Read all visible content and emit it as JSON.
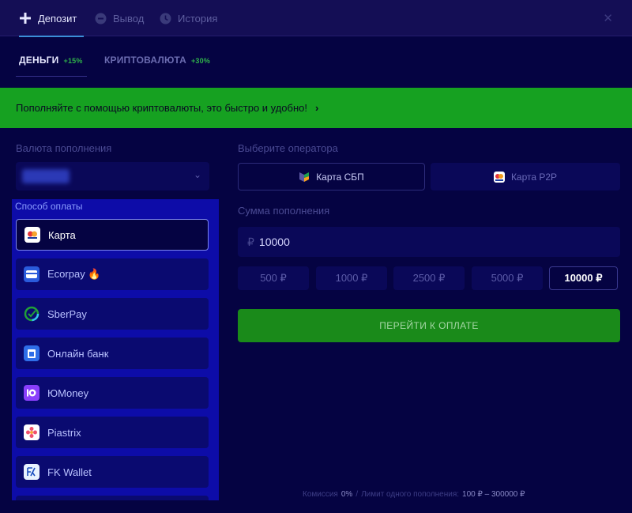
{
  "top_tabs": [
    {
      "label": "Депозит",
      "icon": "plus-icon",
      "active": true
    },
    {
      "label": "Вывод",
      "icon": "minus-circle-icon",
      "active": false
    },
    {
      "label": "История",
      "icon": "clock-icon",
      "active": false
    }
  ],
  "close_symbol": "✕",
  "sub_tabs": [
    {
      "label": "ДЕНЬГИ",
      "bonus": "+15%",
      "active": true
    },
    {
      "label": "КРИПТОВАЛЮТА",
      "bonus": "+30%",
      "active": false
    }
  ],
  "banner": {
    "text": "Пополняйте с помощью криптовалюты, это быстро и удобно!",
    "arrow": "›"
  },
  "currency": {
    "label": "Валюта пополнения",
    "chevron": "⌄"
  },
  "payment_methods": {
    "title": "Способ оплаты",
    "items": [
      {
        "label": "Карта",
        "icon": "visa-card-icon",
        "active": true
      },
      {
        "label": "Ecorpay 🔥",
        "icon": "ecorpay-icon",
        "active": false
      },
      {
        "label": "SberPay",
        "icon": "sberpay-icon",
        "active": false
      },
      {
        "label": "Онлайн банк",
        "icon": "online-bank-icon",
        "active": false
      },
      {
        "label": "ЮMoney",
        "icon": "yumoney-icon",
        "active": false
      },
      {
        "label": "Piastrix",
        "icon": "piastrix-icon",
        "active": false
      },
      {
        "label": "FK Wallet",
        "icon": "fk-wallet-icon",
        "active": false
      }
    ]
  },
  "operator": {
    "label": "Выберите оператора",
    "options": [
      {
        "label": "Карта СБП",
        "icon": "sbp-icon",
        "active": true
      },
      {
        "label": "Карта P2P",
        "icon": "p2p-card-icon",
        "active": false
      }
    ]
  },
  "amount": {
    "label": "Сумма пополнения",
    "currency_symbol": "₽",
    "value": "10000"
  },
  "presets": [
    {
      "label": "500 ₽",
      "active": false
    },
    {
      "label": "1000 ₽",
      "active": false
    },
    {
      "label": "2500 ₽",
      "active": false
    },
    {
      "label": "5000 ₽",
      "active": false
    },
    {
      "label": "10000 ₽",
      "active": true
    }
  ],
  "submit_label": "ПЕРЕЙТИ К ОПЛАТЕ",
  "footer": {
    "commission_label": "Комиссия",
    "commission_value": "0%",
    "separator": "/",
    "limit_label": "Лимит одного пополнения:",
    "limit_value": "100 ₽ – 300000 ₽"
  },
  "colors": {
    "background": "#050342",
    "accent_green": "#16a121",
    "methods_panel": "#0d0ca8",
    "tab_underline": "#3b8fd8"
  }
}
